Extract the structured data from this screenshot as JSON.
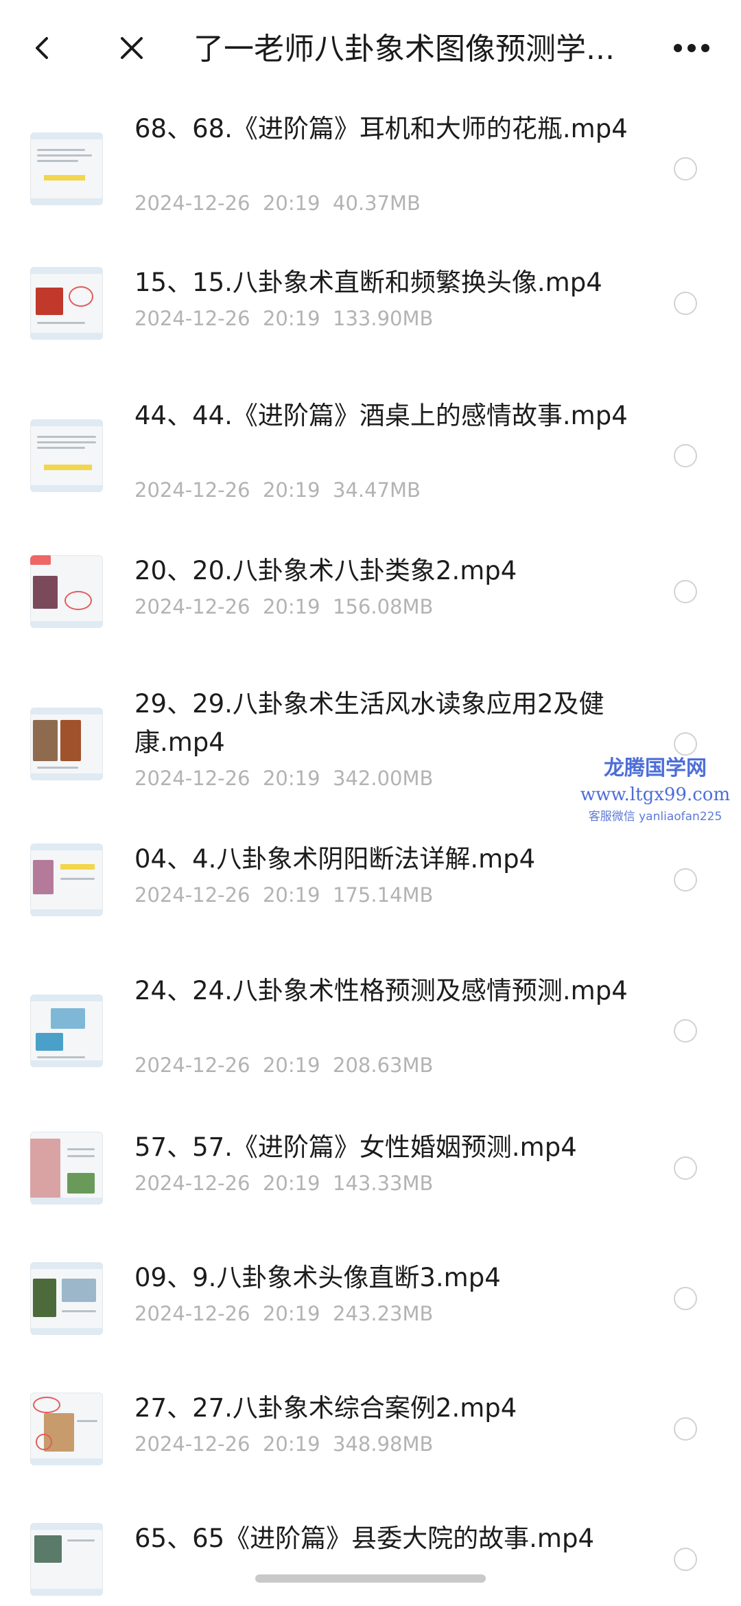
{
  "header": {
    "title": "了一老师八卦象术图像预测学...",
    "back_icon": "chevron-left-icon",
    "close_icon": "close-icon",
    "more_icon": "more-horizontal-icon"
  },
  "files": [
    {
      "name": "68、68.《进阶篇》耳机和大师的花瓶.mp4",
      "date": "2024-12-26",
      "time": "20:19",
      "size": "40.37MB"
    },
    {
      "name": "15、15.八卦象术直断和频繁换头像.mp4",
      "date": "2024-12-26",
      "time": "20:19",
      "size": "133.90MB"
    },
    {
      "name": "44、44.《进阶篇》酒桌上的感情故事.mp4",
      "date": "2024-12-26",
      "time": "20:19",
      "size": "34.47MB"
    },
    {
      "name": "20、20.八卦象术八卦类象2.mp4",
      "date": "2024-12-26",
      "time": "20:19",
      "size": "156.08MB"
    },
    {
      "name": "29、29.八卦象术生活风水读象应用2及健康.mp4",
      "date": "2024-12-26",
      "time": "20:19",
      "size": "342.00MB"
    },
    {
      "name": "04、4.八卦象术阴阳断法详解.mp4",
      "date": "2024-12-26",
      "time": "20:19",
      "size": "175.14MB"
    },
    {
      "name": "24、24.八卦象术性格预测及感情预测.mp4",
      "date": "2024-12-26",
      "time": "20:19",
      "size": "208.63MB"
    },
    {
      "name": "57、57.《进阶篇》女性婚姻预测.mp4",
      "date": "2024-12-26",
      "time": "20:19",
      "size": "143.33MB"
    },
    {
      "name": "09、9.八卦象术头像直断3.mp4",
      "date": "2024-12-26",
      "time": "20:19",
      "size": "243.23MB"
    },
    {
      "name": "27、27.八卦象术综合案例2.mp4",
      "date": "2024-12-26",
      "time": "20:19",
      "size": "348.98MB"
    },
    {
      "name": "65、65《进阶篇》县委大院的故事.mp4",
      "date": "",
      "time": "",
      "size": ""
    }
  ],
  "watermark": {
    "name": "龙腾国学网",
    "url": "www.ltgx99.com",
    "wechat": "客服微信 yanliaofan225"
  },
  "colors": {
    "text_primary": "#1c1c1c",
    "text_secondary": "#b3b3b3",
    "watermark": "#4d6ed8"
  }
}
